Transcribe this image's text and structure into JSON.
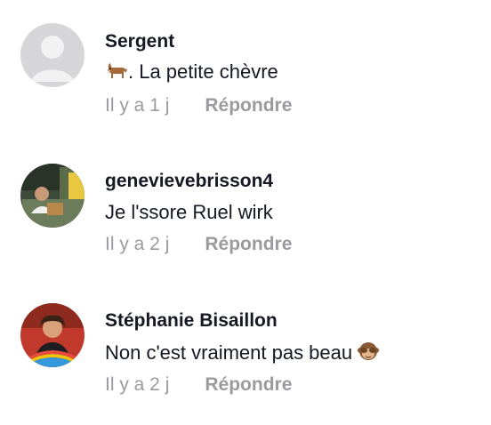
{
  "comments": [
    {
      "username": "Sergent",
      "text": ". La petite chèvre",
      "emoji_before": "goat-emoji",
      "time": "Il y a 1 j",
      "reply_label": "Répondre",
      "avatar": "default-avatar-icon"
    },
    {
      "username": "genevievebrisson4",
      "text": "Je l'ssore Ruel wirk",
      "time": "Il y a 2 j",
      "reply_label": "Répondre",
      "avatar": "user-photo-avatar"
    },
    {
      "username": "Stéphanie Bisaillon",
      "text": "Non c'est vraiment pas beau ",
      "emoji_after": "see-no-evil-monkey-emoji",
      "time": "Il y a 2 j",
      "reply_label": "Répondre",
      "avatar": "user-photo-avatar"
    }
  ],
  "colors": {
    "text": "#161823",
    "muted": "#9a9a9f",
    "background": "#ffffff"
  }
}
